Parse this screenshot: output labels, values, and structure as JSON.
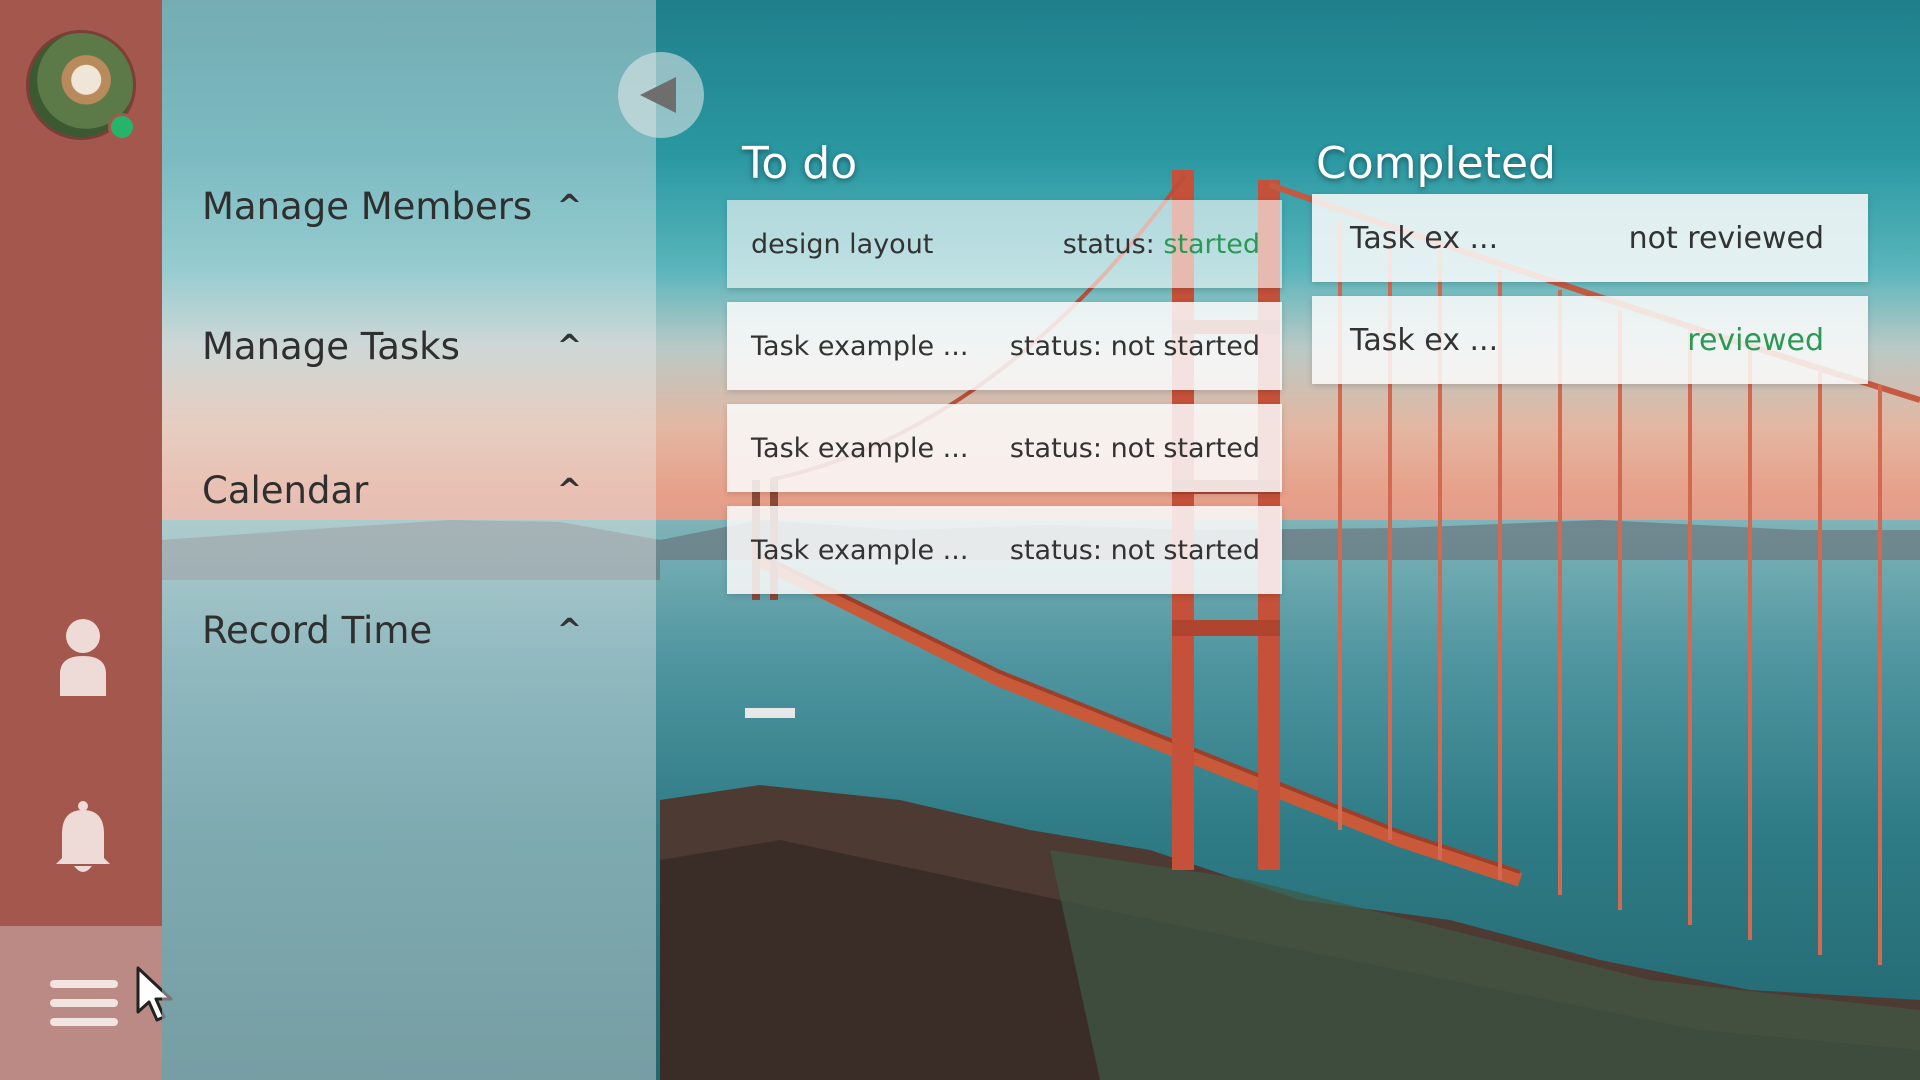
{
  "colors": {
    "rail": "#a3574d",
    "rail_highlight": "#bb8a84",
    "status_green": "#2a9955",
    "presence": "#26b36a"
  },
  "rail": {
    "avatar_icon": "avatar-dog-photo",
    "icons": [
      "person-icon",
      "bell-icon",
      "hamburger-menu-icon"
    ]
  },
  "nav": {
    "items": [
      {
        "label": "Manage Members",
        "caret": "^"
      },
      {
        "label": "Manage Tasks",
        "caret": "^"
      },
      {
        "label": "Calendar",
        "caret": "^"
      },
      {
        "label": "Record Time",
        "caret": "^"
      }
    ]
  },
  "todo": {
    "title": "To do",
    "tasks": [
      {
        "name": "design layout",
        "status_prefix": "status:",
        "status": "started"
      },
      {
        "name": "Task example ...",
        "status_prefix": "status:",
        "status": "not started"
      },
      {
        "name": "Task example ...",
        "status_prefix": "status:",
        "status": "not started"
      },
      {
        "name": "Task example ...",
        "status_prefix": "status:",
        "status": "not started"
      }
    ]
  },
  "completed": {
    "title": "Completed",
    "tasks": [
      {
        "name": "Task ex ...",
        "review": "not reviewed"
      },
      {
        "name": "Task ex ...",
        "review": "reviewed"
      }
    ]
  }
}
